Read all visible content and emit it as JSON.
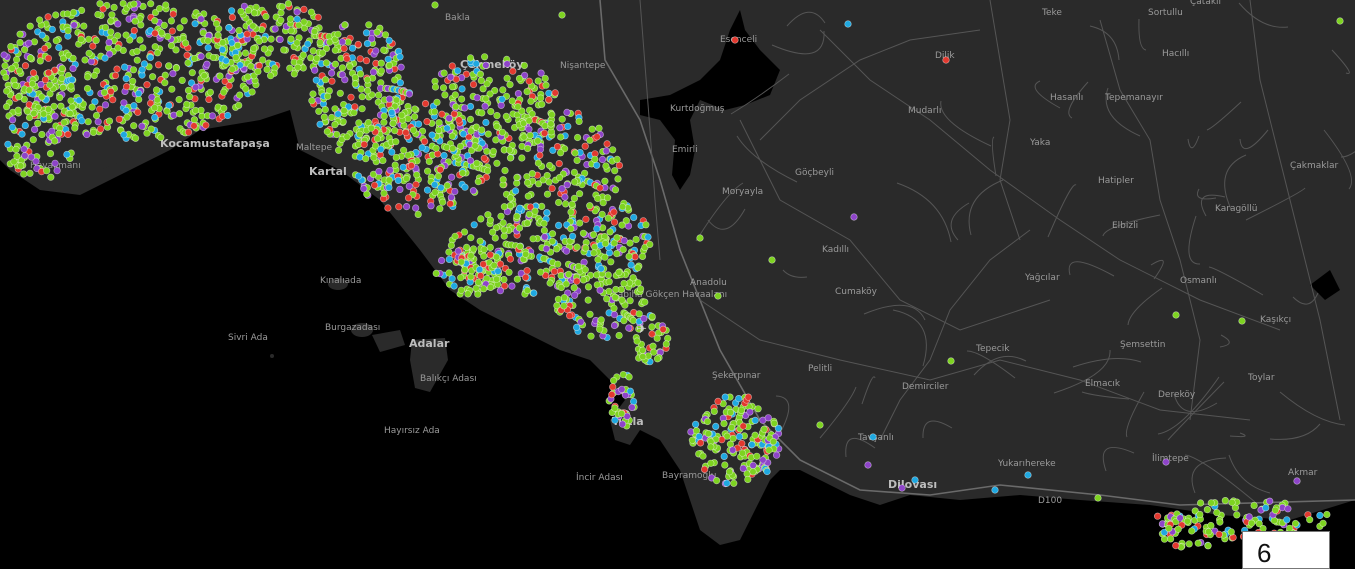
{
  "map": {
    "colors": {
      "sea": "#000000",
      "land": "#2a2a2a",
      "road": "#555555",
      "green": "#7ed321",
      "blue": "#1fa8e0",
      "purple": "#8e44c9",
      "red": "#e2392f"
    },
    "places": [
      {
        "name": "Hasanlı"
      },
      {
        "name": "Tepemanayır"
      },
      {
        "name": "Mudarlı"
      },
      {
        "name": "Sortullu"
      },
      {
        "name": "Hacıllı"
      },
      {
        "name": "Çatakli"
      },
      {
        "name": "Teke"
      },
      {
        "name": "Esenceli"
      },
      {
        "name": "Kurtdoğmuş"
      },
      {
        "name": "Emirli"
      },
      {
        "name": "Moryayla"
      },
      {
        "name": "Göçbeyli"
      },
      {
        "name": "Yaka"
      },
      {
        "name": "Hatipler"
      },
      {
        "name": "Karagöllü"
      },
      {
        "name": "Çakmaklar"
      },
      {
        "name": "Elbizli"
      },
      {
        "name": "Kadıllı"
      },
      {
        "name": "Cumaköy"
      },
      {
        "name": "Anadolu"
      },
      {
        "name": "Yağcılar"
      },
      {
        "name": "Osmanlı"
      },
      {
        "name": "Kaşıkçı"
      },
      {
        "name": "Şemsettin"
      },
      {
        "name": "Tepecik"
      },
      {
        "name": "Pelitli"
      },
      {
        "name": "Şekerpınar"
      },
      {
        "name": "Demirciler"
      },
      {
        "name": "Elmacık"
      },
      {
        "name": "Dereköy"
      },
      {
        "name": "Toylar"
      },
      {
        "name": "Yukarıhereke"
      },
      {
        "name": "Tavşanlı"
      },
      {
        "name": "Dilovası"
      },
      {
        "name": "İlimtepe"
      },
      {
        "name": "Akmar"
      },
      {
        "name": "Sivri Ada"
      },
      {
        "name": "Kınalıada"
      },
      {
        "name": "Burgazadası"
      },
      {
        "name": "Adalar"
      },
      {
        "name": "Balıkçı Adası"
      },
      {
        "name": "Hayırsız Ada"
      },
      {
        "name": "İncir Adası"
      },
      {
        "name": "Sabiha Gökçen Havaalanı"
      },
      {
        "name": "Havalimanı"
      },
      {
        "name": "Nişantepe"
      },
      {
        "name": "Çekmeköy"
      },
      {
        "name": "Dilik"
      },
      {
        "name": "Bakla"
      },
      {
        "name": "Tuzla"
      },
      {
        "name": "Bayramoğlu"
      },
      {
        "name": "D100"
      },
      {
        "name": "Kartal"
      },
      {
        "name": "Maltepe"
      },
      {
        "name": "Kocamustafapaşa"
      }
    ]
  },
  "page_badge": {
    "number": "6"
  }
}
